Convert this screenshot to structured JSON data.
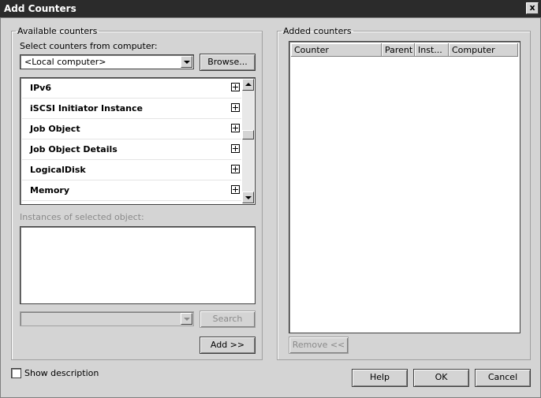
{
  "window": {
    "title": "Add Counters",
    "close_glyph": "x"
  },
  "available": {
    "legend": "Available counters",
    "select_label": "Select counters from computer:",
    "computer_value": "<Local computer>",
    "browse_label": "Browse...",
    "objects": [
      {
        "name": "IPv6"
      },
      {
        "name": "iSCSI Initiator Instance"
      },
      {
        "name": "Job Object"
      },
      {
        "name": "Job Object Details"
      },
      {
        "name": "LogicalDisk"
      },
      {
        "name": "Memory"
      }
    ],
    "instances_label": "Instances of selected object:",
    "search_label": "Search",
    "add_label": "Add >>"
  },
  "added": {
    "legend": "Added counters",
    "columns": [
      "Counter",
      "Parent",
      "Inst...",
      "Computer"
    ],
    "remove_label": "Remove <<"
  },
  "footer": {
    "show_description": "Show description",
    "help_label": "Help",
    "ok_label": "OK",
    "cancel_label": "Cancel"
  }
}
